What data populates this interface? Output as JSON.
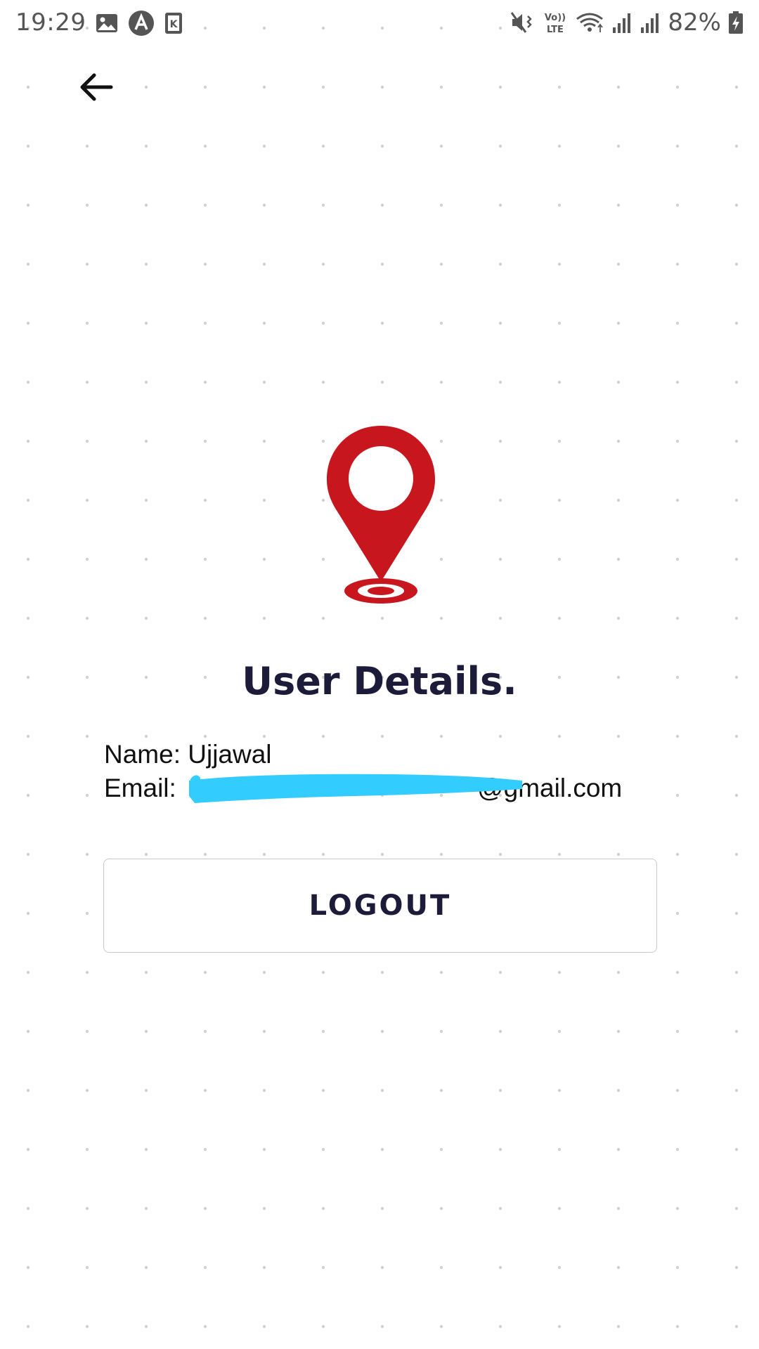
{
  "status_bar": {
    "time": "19:29",
    "left_icons": [
      "gallery-icon",
      "a-circle-icon",
      "k-app-icon"
    ],
    "right_icons": [
      "mute-vibrate-icon",
      "volte-icon",
      "wifi-icon",
      "signal-1-icon",
      "signal-2-icon"
    ],
    "volte_line1": "Vo))",
    "volte_line2": "LTE",
    "battery_percent": "82%",
    "battery_icon": "battery-charging-icon"
  },
  "header": {
    "back_icon": "back-arrow-icon"
  },
  "hero": {
    "icon": "location-pin-icon",
    "pin_color": "#c8161e"
  },
  "user_details": {
    "title": "User Details.",
    "name_label": "Name:",
    "name_value": "Ujjawal",
    "email_label": "Email:",
    "email_visible_suffix": "@gmail.com"
  },
  "actions": {
    "logout_label": "LOGOUT"
  },
  "colors": {
    "text_dark": "#1c1c3a",
    "redaction": "#33ccff",
    "border": "#c9c9c9"
  }
}
